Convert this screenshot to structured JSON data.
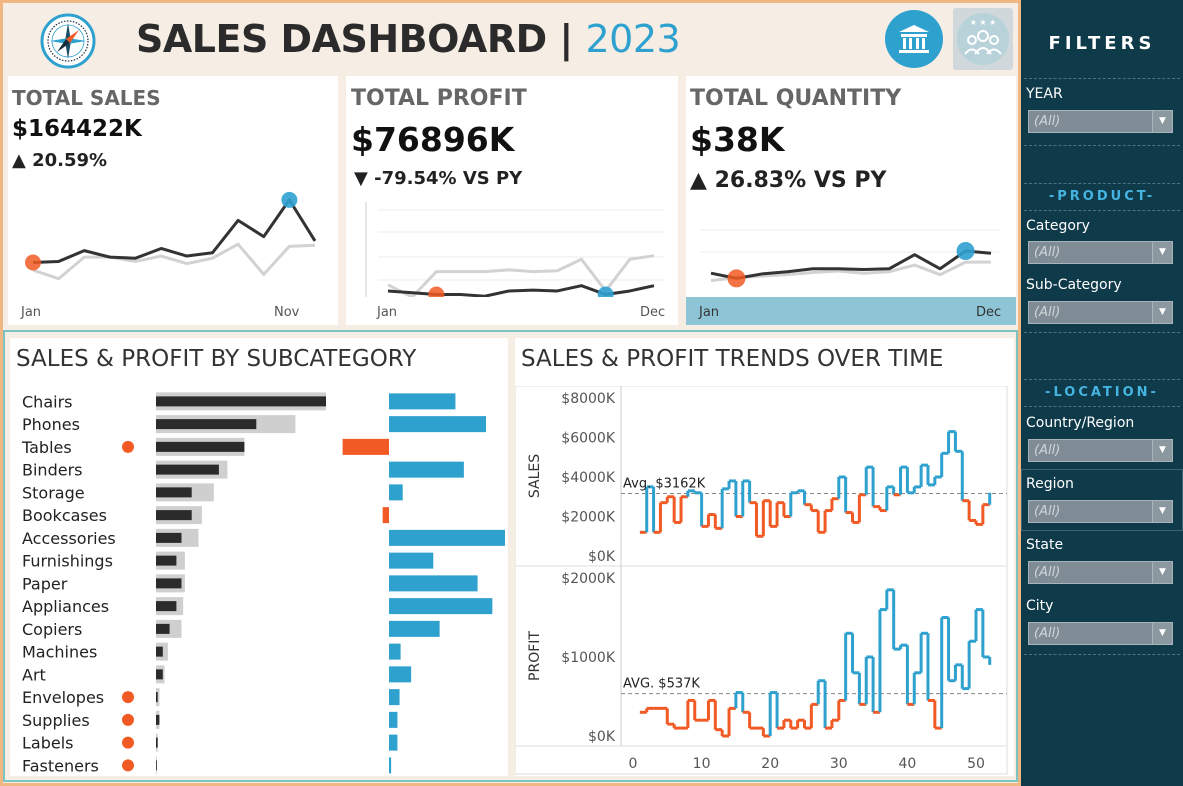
{
  "header": {
    "title": "SALES DASHBOARD",
    "separator": "|",
    "year": "2023"
  },
  "kpis": {
    "sales": {
      "label": "TOTAL SALES",
      "value": "$164422K",
      "delta": "▲ 20.59%",
      "x_start": "Jan",
      "x_end": "Nov"
    },
    "profit": {
      "label": "TOTAL PROFIT",
      "value": "$76896K",
      "delta": "▼ -79.54% VS PY",
      "x_start": "Jan",
      "x_end": "Dec"
    },
    "quantity": {
      "label": "TOTAL QUANTITY",
      "value": "$38K",
      "delta": "▲ 26.83% VS PY",
      "x_start": "Jan",
      "x_end": "Dec"
    }
  },
  "subcat": {
    "title": "SALES & PROFIT BY SUBCATEGORY"
  },
  "trends": {
    "title": "SALES & PROFIT TRENDS OVER TIME",
    "sales_avg": "Avg. $3162K",
    "profit_avg": "AVG. $537K"
  },
  "filters": {
    "title": "FILTERS",
    "year_label": "YEAR",
    "year_value": "(All)",
    "product_section": "-PRODUCT-",
    "category_label": "Category",
    "category_value": "(All)",
    "subcategory_label": "Sub-Category",
    "subcategory_value": "(All)",
    "location_section": "-LOCATION-",
    "country_label": "Country/Region",
    "country_value": "(All)",
    "region_label": "Region",
    "region_value": "(All)",
    "state_label": "State",
    "state_value": "(All)",
    "city_label": "City",
    "city_value": "(All)"
  },
  "colors": {
    "accent_blue": "#2ea1cf",
    "accent_orange": "#f15a24",
    "dark_teal": "#0e3a4a",
    "bar_dark": "#2b2b2b",
    "bar_light": "#cfcfcf"
  },
  "chart_data": [
    {
      "type": "line",
      "id": "kpi_sales",
      "x": [
        1,
        2,
        3,
        4,
        5,
        6,
        7,
        8,
        9,
        10,
        11,
        12
      ],
      "series": [
        {
          "values": [
            31,
            32,
            42,
            36,
            35,
            44,
            37,
            40,
            70,
            55,
            89,
            51
          ]
        },
        {
          "values": [
            24,
            16,
            36,
            36,
            32,
            37,
            30,
            35,
            48,
            20,
            46,
            47
          ]
        }
      ]
    },
    {
      "type": "line",
      "id": "kpi_profit",
      "x": [
        1,
        2,
        3,
        4,
        5,
        6,
        7,
        8,
        9,
        10,
        11,
        12
      ],
      "series": [
        {
          "values": [
            8,
            6,
            4,
            4,
            2,
            8,
            9,
            8,
            14,
            4,
            8,
            14
          ]
        },
        {
          "values": [
            15,
            1,
            30,
            30,
            30,
            32,
            30,
            31,
            44,
            8,
            44,
            48
          ]
        }
      ]
    },
    {
      "type": "line",
      "id": "kpi_quantity",
      "x": [
        1,
        2,
        3,
        4,
        5,
        6,
        7,
        8,
        9,
        10,
        11,
        12
      ],
      "series": [
        {
          "values": [
            20,
            13,
            19,
            22,
            26,
            26,
            25,
            26,
            45,
            26,
            50,
            47
          ]
        },
        {
          "values": [
            10,
            14,
            16,
            18,
            21,
            23,
            20,
            22,
            31,
            18,
            35,
            35
          ]
        }
      ]
    },
    {
      "type": "bar",
      "id": "subcategory",
      "categories": [
        "Chairs",
        "Phones",
        "Tables",
        "Binders",
        "Storage",
        "Bookcases",
        "Accessories",
        "Furnishings",
        "Paper",
        "Appliances",
        "Copiers",
        "Machines",
        "Art",
        "Envelopes",
        "Supplies",
        "Labels",
        "Fasteners"
      ],
      "flagged": [
        false,
        false,
        true,
        false,
        false,
        false,
        false,
        false,
        false,
        false,
        false,
        false,
        false,
        true,
        true,
        true,
        true
      ],
      "series": [
        {
          "values": [
            100,
            82,
            52,
            42,
            34,
            27,
            25,
            17,
            17,
            16,
            15,
            7,
            5,
            2,
            2,
            1,
            0.5
          ]
        },
        {
          "values": [
            100,
            59,
            52,
            37,
            21,
            21,
            15,
            12,
            15,
            12,
            8,
            4,
            4,
            1,
            2,
            1,
            0.5
          ]
        },
        {
          "values": [
            63,
            92,
            -44,
            71,
            13,
            -6,
            110,
            42,
            84,
            98,
            48,
            11,
            21,
            10,
            8,
            8,
            2
          ]
        }
      ]
    },
    {
      "type": "line",
      "id": "weekly_sales",
      "xlabel": "",
      "ylabel": "SALES",
      "yticks": [
        "$0K",
        "$2000K",
        "$4000K",
        "$6000K",
        "$8000K"
      ],
      "ylim": [
        0,
        8000
      ],
      "xticks": [
        0,
        10,
        20,
        30,
        40,
        50
      ],
      "xlim": [
        0,
        52
      ],
      "avg": 3162,
      "x": [
        1,
        2,
        3,
        4,
        5,
        6,
        7,
        8,
        9,
        10,
        11,
        12,
        13,
        14,
        15,
        16,
        17,
        18,
        19,
        20,
        21,
        22,
        23,
        24,
        25,
        26,
        27,
        28,
        29,
        30,
        31,
        32,
        33,
        34,
        35,
        36,
        37,
        38,
        39,
        40,
        41,
        42,
        43,
        44,
        45,
        46,
        47,
        48,
        49,
        50,
        51,
        52
      ],
      "values": [
        1200,
        3500,
        1200,
        2700,
        3000,
        1700,
        3000,
        3300,
        3200,
        1500,
        2100,
        1400,
        3400,
        3800,
        2000,
        3800,
        2700,
        1000,
        2800,
        1500,
        2700,
        2000,
        3200,
        3300,
        2600,
        2300,
        1200,
        2300,
        2900,
        4000,
        2200,
        1700,
        3100,
        4500,
        2500,
        2300,
        3500,
        3100,
        4500,
        3200,
        3500,
        4600,
        3600,
        4000,
        5200,
        6300,
        5300,
        2800,
        1800,
        1600,
        2600,
        3200
      ]
    },
    {
      "type": "line",
      "id": "weekly_profit",
      "xlabel": "",
      "ylabel": "PROFIT",
      "yticks": [
        "$0K",
        "$1000K",
        "$2000K"
      ],
      "ylim": [
        0,
        2000
      ],
      "xticks": [
        0,
        10,
        20,
        30,
        40,
        50
      ],
      "xlim": [
        0,
        52
      ],
      "avg": 537,
      "x": [
        1,
        2,
        3,
        4,
        5,
        6,
        7,
        8,
        9,
        10,
        11,
        12,
        13,
        14,
        15,
        16,
        17,
        18,
        19,
        20,
        21,
        22,
        23,
        24,
        25,
        26,
        27,
        28,
        29,
        30,
        31,
        32,
        33,
        34,
        35,
        36,
        37,
        38,
        39,
        40,
        41,
        42,
        43,
        44,
        45,
        46,
        47,
        48,
        49,
        50,
        51,
        52
      ],
      "values": [
        300,
        350,
        350,
        350,
        150,
        100,
        100,
        450,
        200,
        200,
        450,
        80,
        0,
        350,
        550,
        300,
        100,
        100,
        0,
        550,
        100,
        200,
        100,
        200,
        100,
        400,
        700,
        100,
        200,
        450,
        1300,
        800,
        400,
        1000,
        300,
        1600,
        1850,
        1100,
        1150,
        400,
        800,
        1300,
        450,
        100,
        1500,
        700,
        900,
        600,
        1200,
        1600,
        1000,
        900
      ]
    }
  ]
}
